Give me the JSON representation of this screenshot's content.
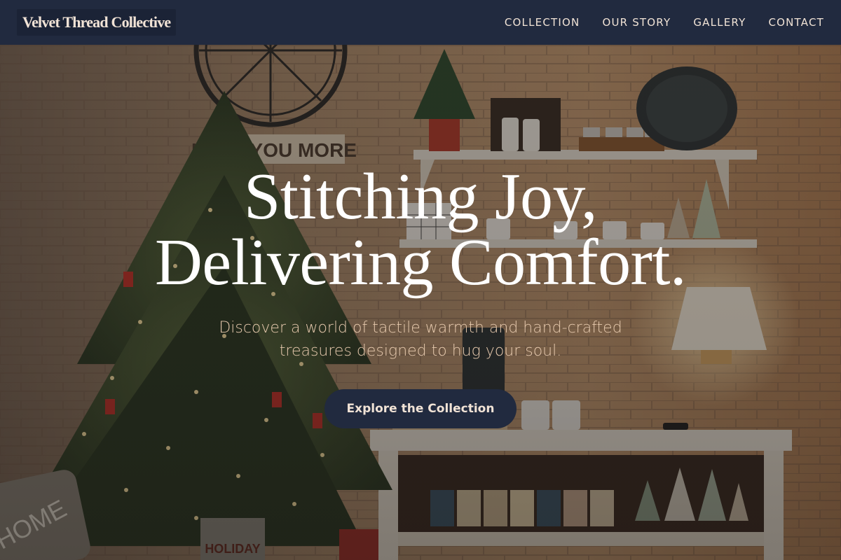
{
  "brand": {
    "name": "Velvet Thread Collective"
  },
  "nav": {
    "items": [
      {
        "label": "COLLECTION"
      },
      {
        "label": "OUR STORY"
      },
      {
        "label": "GALLERY"
      },
      {
        "label": "CONTACT"
      }
    ]
  },
  "hero": {
    "headline_line1": "Stitching Joy,",
    "headline_line2": "Delivering Comfort.",
    "subtext": "Discover a world of tactile warmth and hand-crafted treasures designed to hug your soul.",
    "cta_label": "Explore the Collection",
    "background_image": {
      "sign_text": "LOVE YOU MORE",
      "pillow_text": "HOME",
      "basket_text": "HOLIDAY"
    }
  },
  "colors": {
    "nav_background": "#212a3f",
    "nav_text": "#f1e3d6",
    "headline": "#ffffff",
    "subtext": "#e6c9ad",
    "cta_background": "#212a3f",
    "cta_text": "#f1e3d6"
  }
}
